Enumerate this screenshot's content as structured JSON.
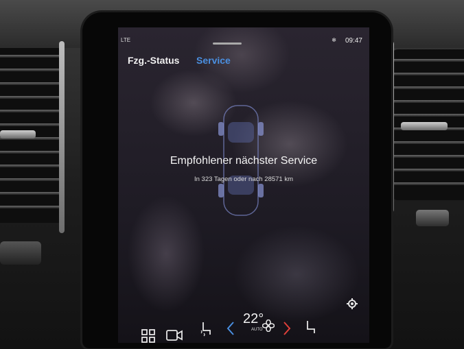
{
  "status_bar": {
    "network": "LTE",
    "time": "09:47"
  },
  "tabs": [
    {
      "label": "Fzg.-Status",
      "active": false
    },
    {
      "label": "Service",
      "active": true
    }
  ],
  "service": {
    "headline": "Empfohlener nächster Service",
    "detail": "In 323 Tagen oder nach 28571 km"
  },
  "climate": {
    "temperature": "22°",
    "mode": "AUTO"
  },
  "icons": [
    "home-grid-icon",
    "camera-icon",
    "seat-heat-left-icon",
    "chevron-left-icon",
    "fan-icon",
    "chevron-right-icon",
    "seat-right-icon",
    "settings-gear-icon"
  ],
  "colors": {
    "accent": "#4a8fe0",
    "chevron_left": "#4a8fe0",
    "chevron_right": "#e0403a"
  }
}
